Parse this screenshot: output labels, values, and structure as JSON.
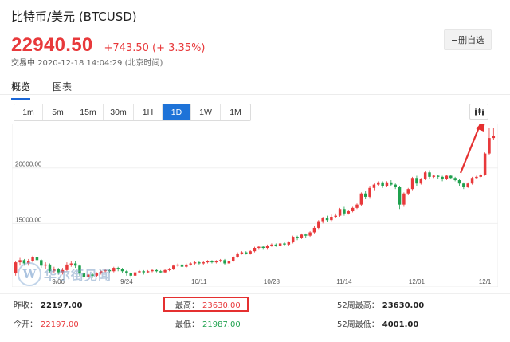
{
  "header": {
    "title": "比特币/美元 (BTCUSD)",
    "price": "22940.50",
    "change": "+743.50 (+ 3.35%)",
    "status_label": "交易中",
    "timestamp": "2020-12-18 14:04:29 (北京时间)",
    "remove_watchlist_label": "−删自选"
  },
  "view_tabs": [
    {
      "label": "概览",
      "active": true
    },
    {
      "label": "图表",
      "active": false
    }
  ],
  "periods": [
    {
      "label": "1m",
      "active": false
    },
    {
      "label": "5m",
      "active": false
    },
    {
      "label": "15m",
      "active": false
    },
    {
      "label": "30m",
      "active": false
    },
    {
      "label": "1H",
      "active": false
    },
    {
      "label": "1D",
      "active": true
    },
    {
      "label": "1W",
      "active": false
    },
    {
      "label": "1M",
      "active": false
    }
  ],
  "chart_type_icon": "candlestick-icon",
  "colors": {
    "up": "#e8393b",
    "down": "#1fa14e",
    "accent": "#1e73d8",
    "annotation": "#e53030"
  },
  "chart_data": {
    "type": "candlestick",
    "x_ticks": [
      "9/06",
      "9/24",
      "10/11",
      "10/28",
      "11/14",
      "12/01",
      "12/1"
    ],
    "y_ticks": [
      "20000.00",
      "15000.00"
    ],
    "ylim": [
      10000,
      24000
    ],
    "grid": true,
    "candles": [
      [
        10500,
        11500,
        10300,
        11600
      ],
      [
        11500,
        11700,
        11200,
        11900
      ],
      [
        11700,
        11400,
        11200,
        11800
      ],
      [
        11400,
        11600,
        11200,
        11800
      ],
      [
        11600,
        12000,
        11500,
        12100
      ],
      [
        12000,
        11700,
        11500,
        12100
      ],
      [
        11700,
        11200,
        11000,
        11800
      ],
      [
        11200,
        11300,
        10900,
        11500
      ],
      [
        11300,
        10700,
        10500,
        11400
      ],
      [
        10700,
        10900,
        10500,
        11100
      ],
      [
        10900,
        10600,
        10400,
        11000
      ],
      [
        10600,
        10800,
        10400,
        11000
      ],
      [
        10800,
        11300,
        10700,
        11500
      ],
      [
        11300,
        11400,
        11100,
        11600
      ],
      [
        11400,
        11200,
        11000,
        11600
      ],
      [
        11200,
        10500,
        10300,
        11300
      ],
      [
        10500,
        10200,
        10000,
        10600
      ],
      [
        10200,
        10400,
        10100,
        10500
      ],
      [
        10400,
        10300,
        10100,
        10500
      ],
      [
        10300,
        10500,
        10200,
        10600
      ],
      [
        10500,
        10700,
        10400,
        10800
      ],
      [
        10700,
        10800,
        10600,
        10900
      ],
      [
        10800,
        10700,
        10500,
        10900
      ],
      [
        10700,
        11000,
        10600,
        11100
      ],
      [
        11000,
        10900,
        10700,
        11100
      ],
      [
        10900,
        10700,
        10500,
        11000
      ],
      [
        10700,
        10500,
        10300,
        10800
      ],
      [
        10500,
        10300,
        10100,
        10600
      ],
      [
        10300,
        10600,
        10200,
        10700
      ],
      [
        10600,
        10700,
        10500,
        10800
      ],
      [
        10700,
        10600,
        10400,
        10800
      ],
      [
        10600,
        10700,
        10500,
        10800
      ],
      [
        10700,
        10800,
        10600,
        10900
      ],
      [
        10800,
        10700,
        10600,
        10900
      ],
      [
        10700,
        10600,
        10500,
        10800
      ],
      [
        10600,
        10800,
        10500,
        10900
      ],
      [
        10800,
        10900,
        10700,
        11000
      ],
      [
        10900,
        11200,
        10800,
        11300
      ],
      [
        11200,
        11300,
        11100,
        11400
      ],
      [
        11300,
        11100,
        11000,
        11400
      ],
      [
        11100,
        11300,
        11000,
        11400
      ],
      [
        11300,
        11400,
        11200,
        11500
      ],
      [
        11400,
        11500,
        11300,
        11600
      ],
      [
        11500,
        11400,
        11300,
        11600
      ],
      [
        11400,
        11500,
        11300,
        11600
      ],
      [
        11500,
        11600,
        11400,
        11700
      ],
      [
        11600,
        11500,
        11400,
        11700
      ],
      [
        11500,
        11600,
        11400,
        11700
      ],
      [
        11600,
        11700,
        11500,
        11800
      ],
      [
        11700,
        11400,
        11300,
        11800
      ],
      [
        11400,
        11600,
        11300,
        11700
      ],
      [
        11600,
        12000,
        11500,
        12100
      ],
      [
        12000,
        12300,
        11900,
        12400
      ],
      [
        12300,
        12400,
        12200,
        12500
      ],
      [
        12400,
        12300,
        12200,
        12500
      ],
      [
        12300,
        12500,
        12200,
        12600
      ],
      [
        12500,
        12800,
        12400,
        12900
      ],
      [
        12800,
        12900,
        12700,
        13000
      ],
      [
        12900,
        12800,
        12700,
        13000
      ],
      [
        12800,
        13000,
        12700,
        13100
      ],
      [
        13000,
        13100,
        12900,
        13200
      ],
      [
        13100,
        13000,
        12900,
        13200
      ],
      [
        13000,
        13200,
        12900,
        13300
      ],
      [
        13200,
        13100,
        13000,
        13300
      ],
      [
        13100,
        13300,
        13000,
        13400
      ],
      [
        13300,
        13800,
        13200,
        13900
      ],
      [
        13800,
        13700,
        13500,
        13900
      ],
      [
        13700,
        14000,
        13600,
        14100
      ],
      [
        14000,
        13900,
        13700,
        14100
      ],
      [
        13900,
        14200,
        13800,
        14300
      ],
      [
        14200,
        14600,
        14100,
        14800
      ],
      [
        14600,
        15200,
        14500,
        15300
      ],
      [
        15200,
        15500,
        15000,
        15600
      ],
      [
        15500,
        15300,
        15100,
        15700
      ],
      [
        15300,
        15600,
        15200,
        15800
      ],
      [
        15600,
        15700,
        15500,
        15900
      ],
      [
        15700,
        16300,
        15600,
        16400
      ],
      [
        16300,
        15900,
        15700,
        16500
      ],
      [
        15900,
        16100,
        15800,
        16200
      ],
      [
        16100,
        16400,
        16000,
        16500
      ],
      [
        16400,
        16700,
        16300,
        16800
      ],
      [
        16700,
        17700,
        16600,
        17800
      ],
      [
        17700,
        17400,
        17200,
        17900
      ],
      [
        17400,
        18200,
        17300,
        18400
      ],
      [
        18200,
        18500,
        18000,
        18600
      ],
      [
        18500,
        18700,
        18400,
        18800
      ],
      [
        18700,
        18400,
        18200,
        18800
      ],
      [
        18400,
        18700,
        18300,
        18800
      ],
      [
        18700,
        18500,
        18400,
        18900
      ],
      [
        18500,
        18300,
        18100,
        18600
      ],
      [
        18300,
        16700,
        16300,
        18400
      ],
      [
        16700,
        17700,
        16500,
        17800
      ],
      [
        17700,
        18100,
        17600,
        18200
      ],
      [
        18100,
        19100,
        18000,
        19200
      ],
      [
        19100,
        18600,
        18400,
        19300
      ],
      [
        18600,
        19000,
        18500,
        19100
      ],
      [
        19000,
        19600,
        18900,
        19700
      ],
      [
        19600,
        19200,
        19000,
        19800
      ],
      [
        19200,
        19300,
        19100,
        19400
      ],
      [
        19300,
        19200,
        19000,
        19400
      ],
      [
        19200,
        19000,
        18800,
        19300
      ],
      [
        19000,
        19300,
        18900,
        19400
      ],
      [
        19300,
        19100,
        19000,
        19400
      ],
      [
        19100,
        18900,
        18800,
        19200
      ],
      [
        18900,
        18600,
        18400,
        19000
      ],
      [
        18600,
        18300,
        18100,
        18700
      ],
      [
        18300,
        18600,
        18200,
        18700
      ],
      [
        18600,
        19100,
        18500,
        19200
      ],
      [
        19100,
        19200,
        19000,
        19300
      ],
      [
        19200,
        19400,
        19100,
        19500
      ],
      [
        19400,
        21300,
        19300,
        21400
      ],
      [
        21300,
        22700,
        21200,
        23600
      ],
      [
        22700,
        22900,
        22500,
        23600
      ]
    ]
  },
  "stats": [
    {
      "label": "昨收：",
      "value": "22197.00",
      "tone": "dark"
    },
    {
      "label": "最高：",
      "value": "23630.00",
      "tone": "red"
    },
    {
      "label": "52周最高：",
      "value": "23630.00",
      "tone": "dark"
    },
    {
      "label": "今开：",
      "value": "22197.00",
      "tone": "red"
    },
    {
      "label": "最低：",
      "value": "21987.00",
      "tone": "green"
    },
    {
      "label": "52周最低：",
      "value": "4001.00",
      "tone": "dark"
    }
  ],
  "watermark": {
    "mark": "W",
    "text": "华尔街见闻"
  }
}
